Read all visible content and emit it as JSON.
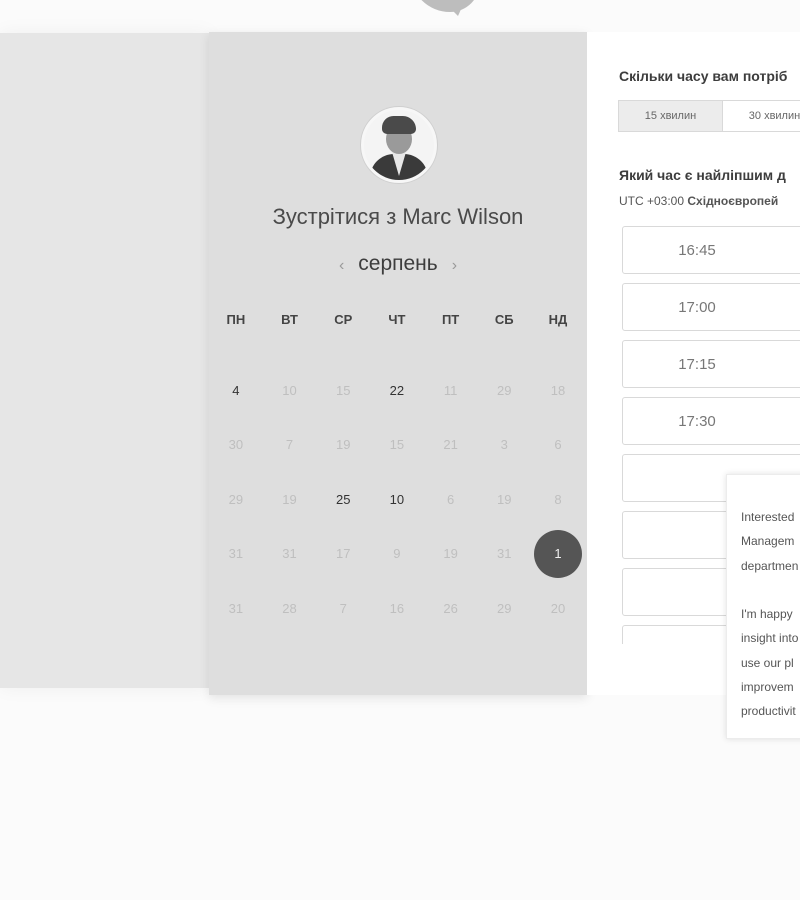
{
  "meeting": {
    "title": "Зустрітися з Marc Wilson"
  },
  "calendar": {
    "month": "серпень",
    "prev_icon": "chevron-left-icon",
    "next_icon": "chevron-right-icon",
    "weekdays": [
      "ПН",
      "ВТ",
      "СР",
      "ЧТ",
      "ПТ",
      "СБ",
      "НД"
    ],
    "weeks": [
      [
        {
          "d": "4",
          "a": true
        },
        {
          "d": "10",
          "a": false
        },
        {
          "d": "15",
          "a": false
        },
        {
          "d": "22",
          "a": true
        },
        {
          "d": "11",
          "a": false
        },
        {
          "d": "29",
          "a": false
        },
        {
          "d": "18",
          "a": false
        }
      ],
      [
        {
          "d": "30",
          "a": false
        },
        {
          "d": "7",
          "a": false
        },
        {
          "d": "19",
          "a": false
        },
        {
          "d": "15",
          "a": false
        },
        {
          "d": "21",
          "a": false
        },
        {
          "d": "3",
          "a": false
        },
        {
          "d": "6",
          "a": false
        }
      ],
      [
        {
          "d": "29",
          "a": false
        },
        {
          "d": "19",
          "a": false
        },
        {
          "d": "25",
          "a": true
        },
        {
          "d": "10",
          "a": true
        },
        {
          "d": "6",
          "a": false
        },
        {
          "d": "19",
          "a": false
        },
        {
          "d": "8",
          "a": false
        }
      ],
      [
        {
          "d": "31",
          "a": false
        },
        {
          "d": "31",
          "a": false
        },
        {
          "d": "17",
          "a": false
        },
        {
          "d": "9",
          "a": false
        },
        {
          "d": "19",
          "a": false
        },
        {
          "d": "31",
          "a": false
        },
        {
          "d": "1",
          "a": true,
          "selected": true
        }
      ],
      [
        {
          "d": "31",
          "a": false
        },
        {
          "d": "28",
          "a": false
        },
        {
          "d": "7",
          "a": false
        },
        {
          "d": "16",
          "a": false
        },
        {
          "d": "26",
          "a": false
        },
        {
          "d": "29",
          "a": false
        },
        {
          "d": "20",
          "a": false
        }
      ]
    ]
  },
  "scheduler": {
    "duration_question": "Скільки часу вам потріб",
    "durations": [
      "15 хвилин",
      "30 хвилин"
    ],
    "time_question": "Який час є найліпшим д",
    "tz_offset": "UTC +03:00",
    "tz_name": "Східноєвропей",
    "slots": [
      "16:45",
      "17:00",
      "17:15",
      "17:30",
      "",
      "",
      "",
      ""
    ]
  },
  "popover": {
    "text": "Interested\nManagem\ndepartmen\n\nI'm happy\ninsight into\nuse our pl\nimprovem\nproductivit"
  }
}
